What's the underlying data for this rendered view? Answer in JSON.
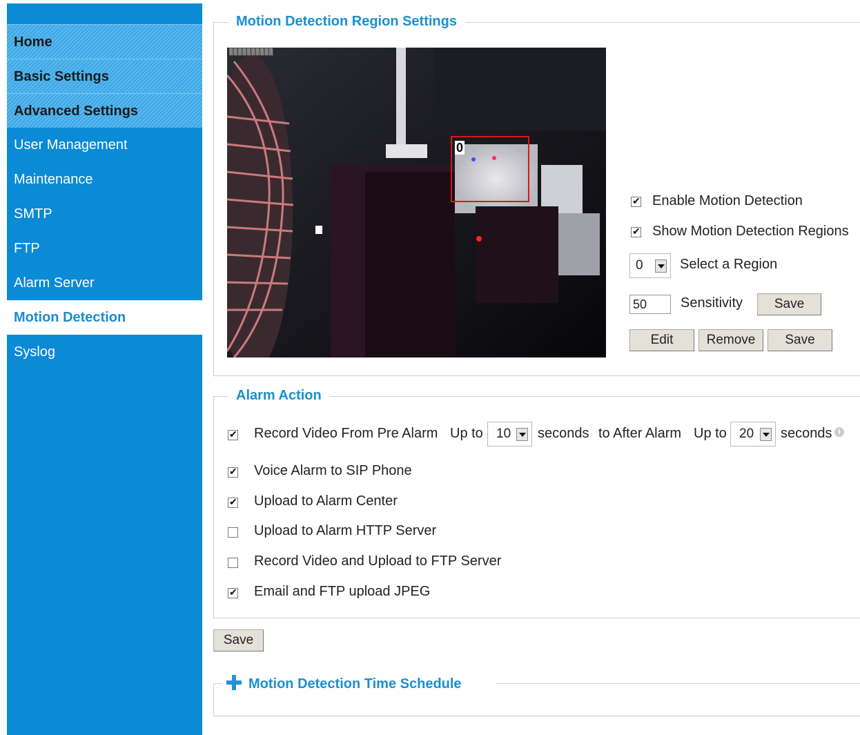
{
  "sidebar": {
    "items": [
      {
        "label": "Home"
      },
      {
        "label": "Basic Settings"
      },
      {
        "label": "Advanced Settings"
      },
      {
        "label": "User Management"
      },
      {
        "label": "Maintenance"
      },
      {
        "label": "SMTP"
      },
      {
        "label": "FTP"
      },
      {
        "label": "Alarm Server"
      },
      {
        "label": "Motion Detection"
      },
      {
        "label": "Syslog"
      }
    ],
    "active": "Motion Detection"
  },
  "region_settings": {
    "legend": "Motion Detection Region Settings",
    "region_label": "0",
    "enable_motion": {
      "label": "Enable Motion Detection",
      "checked": true
    },
    "show_regions": {
      "label": "Show Motion Detection Regions",
      "checked": true
    },
    "select_region": {
      "value": "0",
      "label": "Select a Region"
    },
    "sensitivity": {
      "value": "50",
      "label": "Sensitivity",
      "save_label": "Save"
    },
    "edit_label": "Edit",
    "remove_label": "Remove",
    "save_label": "Save"
  },
  "alarm_action": {
    "legend": "Alarm Action",
    "record_video": {
      "label": "Record Video From Pre Alarm",
      "checked": true,
      "up_to_1": "Up to",
      "pre_value": "10",
      "seconds_1": "seconds",
      "to_after": "to After Alarm",
      "up_to_2": "Up to",
      "post_value": "20",
      "seconds_2": "seconds"
    },
    "voice_alarm": {
      "label": "Voice Alarm to SIP Phone",
      "checked": true
    },
    "upload_center": {
      "label": "Upload to Alarm Center",
      "checked": true
    },
    "upload_http": {
      "label": "Upload to Alarm HTTP Server",
      "checked": false
    },
    "record_ftp": {
      "label": "Record Video and Upload to FTP Server",
      "checked": false
    },
    "email_ftp": {
      "label": "Email and FTP upload JPEG",
      "checked": true
    }
  },
  "save_label": "Save",
  "schedule": {
    "legend": "Motion Detection Time Schedule"
  },
  "colors": {
    "sidebar": "#0b8ad6",
    "accent": "#1b8fcf",
    "region_box": "#d81818"
  }
}
